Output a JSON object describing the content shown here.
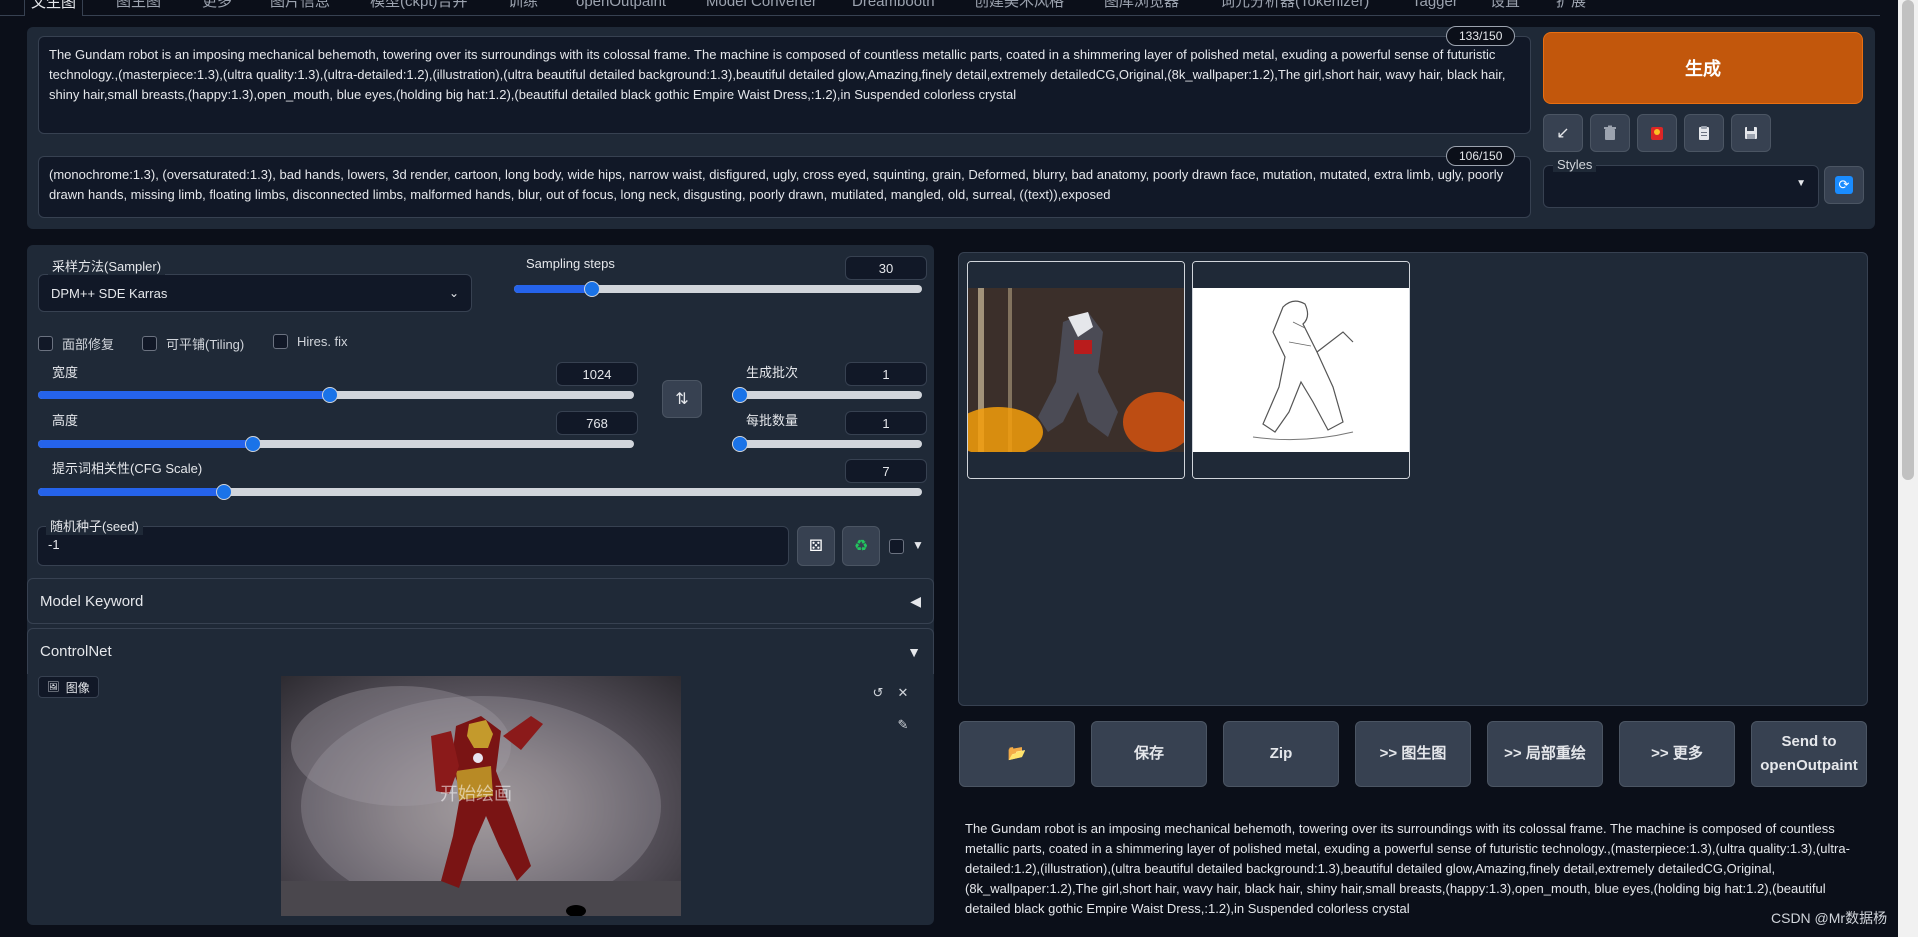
{
  "tabs": [
    "文生图",
    "图生图",
    "更多",
    "图片信息",
    "模型(ckpt)合并",
    "训练",
    "openOutpaint",
    "Model Converter",
    "Dreambooth",
    "创建美术风格",
    "图库浏览器",
    "词元分析器(Tokenizer)",
    "Tagger",
    "设置",
    "扩展"
  ],
  "prompt": {
    "positive": "The Gundam robot is an imposing mechanical behemoth, towering over its surroundings with its colossal frame. The machine is composed of countless metallic parts, coated in a shimmering layer of polished metal, exuding a powerful sense of futuristic technology.,(masterpiece:1.3),(ultra quality:1.3),(ultra-detailed:1.2),(illustration),(ultra beautiful detailed background:1.3),beautiful detailed glow,Amazing,finely detail,extremely detailedCG,Original,(8k_wallpaper:1.2),The girl,short hair, wavy hair, black hair, shiny hair,small breasts,(happy:1.3),open_mouth, blue eyes,(holding big hat:1.2),(beautiful detailed black gothic Empire Waist Dress,:1.2),in Suspended colorless crystal",
    "positive_counter": "133/150",
    "negative": "(monochrome:1.3), (oversaturated:1.3), bad hands, lowers, 3d render, cartoon, long body, wide hips, narrow waist, disfigured, ugly, cross eyed, squinting, grain, Deformed, blurry, bad anatomy, poorly drawn face, mutation, mutated, extra limb, ugly, poorly drawn hands, missing limb, floating limbs, disconnected limbs, malformed hands, blur, out of focus, long neck, disgusting, poorly drawn, mutilated,  mangled, old, surreal, ((text)),exposed",
    "negative_counter": "106/150"
  },
  "generate_label": "生成",
  "styles_label": "Styles",
  "settings": {
    "sampler_label": "采样方法(Sampler)",
    "sampler_value": "DPM++ SDE Karras",
    "steps_label": "Sampling steps",
    "steps_value": "30",
    "steps_fraction": 0.19,
    "restore_faces": "面部修复",
    "tiling": "可平铺(Tiling)",
    "hires_fix": "Hires. fix",
    "width_label": "宽度",
    "width_value": "1024",
    "width_fraction": 0.49,
    "height_label": "高度",
    "height_value": "768",
    "height_fraction": 0.36,
    "batch_count_label": "生成批次",
    "batch_count_value": "1",
    "batch_size_label": "每批数量",
    "batch_size_value": "1",
    "cfg_label": "提示词相关性(CFG Scale)",
    "cfg_value": "7",
    "cfg_fraction": 0.21,
    "seed_label": "随机种子(seed)",
    "seed_value": "-1"
  },
  "accordions": {
    "model_keyword": "Model Keyword",
    "controlnet": "ControlNet"
  },
  "controlnet": {
    "image_tag": "图像",
    "center_text": "开始绘画"
  },
  "output_buttons": [
    "📂",
    "保存",
    "Zip",
    ">> 图生图",
    ">> 局部重绘",
    ">> 更多",
    "Send to\nopenOutpaint"
  ],
  "info_text": "The Gundam robot is an imposing mechanical behemoth, towering over its surroundings with its colossal frame. The machine is composed of countless metallic parts, coated in a shimmering layer of polished metal, exuding a powerful sense of futuristic technology.,(masterpiece:1.3),(ultra quality:1.3),(ultra-detailed:1.2),(illustration),(ultra beautiful detailed background:1.3),beautiful detailed glow,Amazing,finely detail,extremely detailedCG,Original,(8k_wallpaper:1.2),The girl,short hair, wavy hair, black hair, shiny hair,small breasts,(happy:1.3),open_mouth, blue eyes,(holding big hat:1.2),(beautiful detailed black gothic Empire Waist Dress,:1.2),in Suspended colorless crystal",
  "watermark": "CSDN @Mr数据杨",
  "colors": {
    "accent": "#c2570c",
    "background": "#0b0f19",
    "panel": "#1f2937",
    "slider": "#2563eb"
  }
}
